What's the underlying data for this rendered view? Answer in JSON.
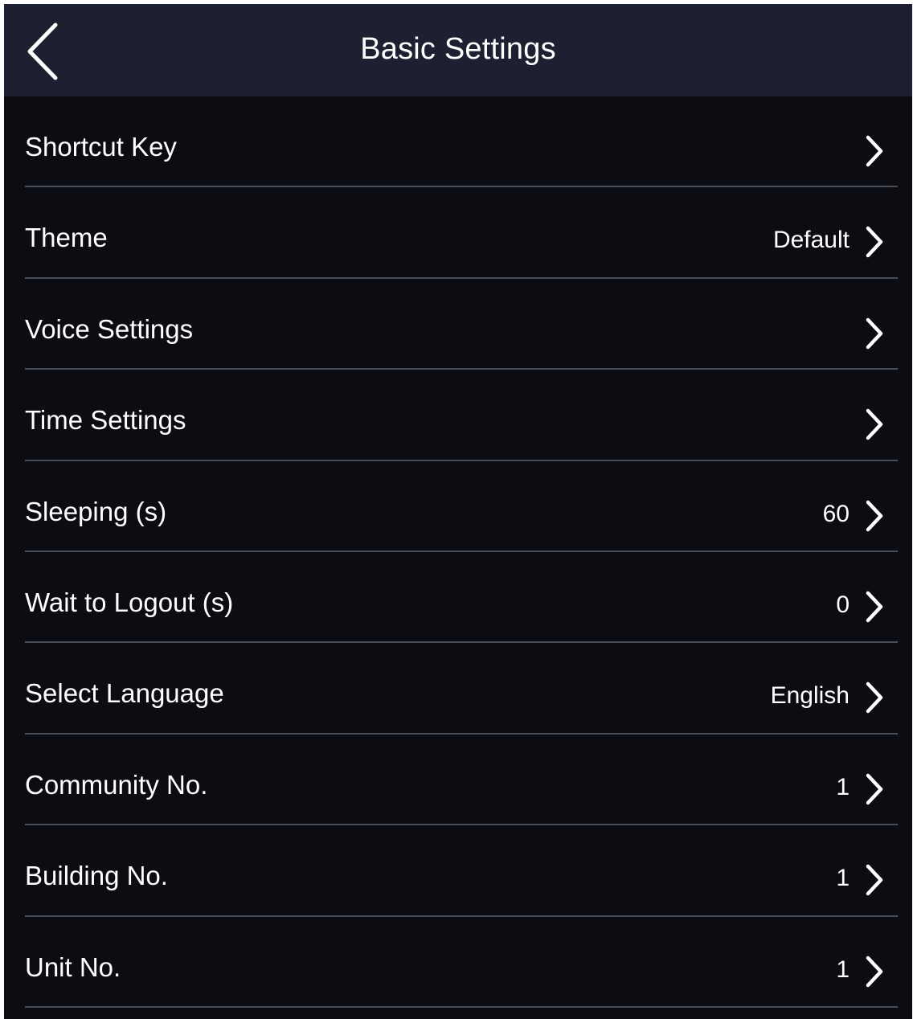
{
  "header": {
    "title": "Basic Settings",
    "back_icon": "chevron-left-icon"
  },
  "colors": {
    "background": "#0c0d13",
    "header_background": "#1d2031",
    "text": "#ffffff",
    "divider": "#4a4c58"
  },
  "settings": {
    "items": [
      {
        "label": "Shortcut Key",
        "value": "",
        "icon": "chevron-right-icon"
      },
      {
        "label": "Theme",
        "value": "Default",
        "icon": "chevron-right-icon"
      },
      {
        "label": "Voice Settings",
        "value": "",
        "icon": "chevron-right-icon"
      },
      {
        "label": "Time Settings",
        "value": "",
        "icon": "chevron-right-icon"
      },
      {
        "label": "Sleeping (s)",
        "value": "60",
        "icon": "chevron-right-icon"
      },
      {
        "label": "Wait to Logout (s)",
        "value": "0",
        "icon": "chevron-right-icon"
      },
      {
        "label": "Select Language",
        "value": "English",
        "icon": "chevron-right-icon"
      },
      {
        "label": "Community No.",
        "value": "1",
        "icon": "chevron-right-icon"
      },
      {
        "label": "Building No.",
        "value": "1",
        "icon": "chevron-right-icon"
      },
      {
        "label": "Unit No.",
        "value": "1",
        "icon": "chevron-right-icon"
      }
    ]
  }
}
